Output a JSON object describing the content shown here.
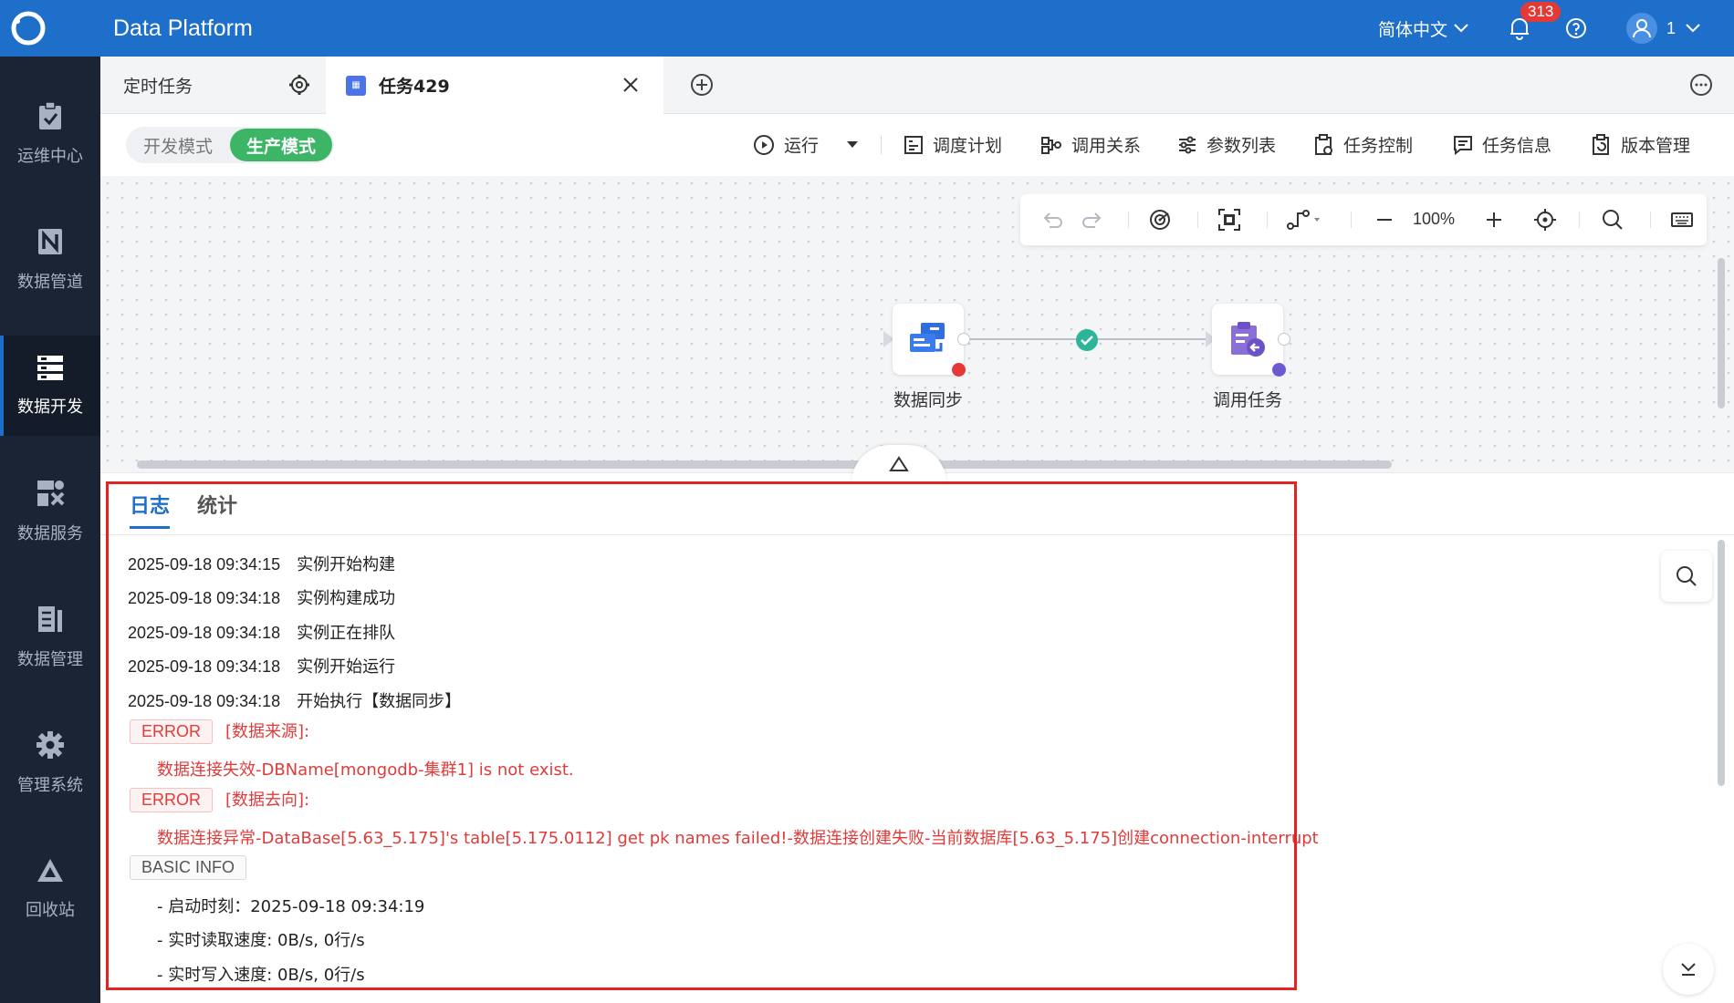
{
  "header": {
    "app_title": "Data Platform",
    "language": "简体中文",
    "notification_count": "313",
    "user_name": "1"
  },
  "sidebar": {
    "items": [
      {
        "label": "运维中心",
        "icon": "clipboard-check-icon"
      },
      {
        "label": "数据管道",
        "icon": "pipeline-icon"
      },
      {
        "label": "数据开发",
        "icon": "server-stack-icon"
      },
      {
        "label": "数据服务",
        "icon": "service-icon"
      },
      {
        "label": "数据管理",
        "icon": "management-icon"
      },
      {
        "label": "管理系统",
        "icon": "gear-icon"
      },
      {
        "label": "回收站",
        "icon": "recycle-icon"
      }
    ],
    "active_index": 2
  },
  "tabs": {
    "items": [
      {
        "label": "定时任务"
      },
      {
        "label": "任务429"
      }
    ]
  },
  "toolbar": {
    "mode_dev": "开发模式",
    "mode_prod": "生产模式",
    "run": "运行",
    "schedule_plan": "调度计划",
    "call_relation": "调用关系",
    "param_list": "参数列表",
    "task_control": "任务控制",
    "task_info": "任务信息",
    "version_mgmt": "版本管理"
  },
  "canvas": {
    "zoom": "100%",
    "nodes": [
      {
        "label": "数据同步",
        "status_color": "#e53935"
      },
      {
        "label": "调用任务",
        "status_color": "#6b5bd2"
      }
    ]
  },
  "log_panel": {
    "tabs": [
      "日志",
      "统计"
    ],
    "lines": [
      {
        "ts": "2025-09-18 09:34:15",
        "msg": "实例开始构建"
      },
      {
        "ts": "2025-09-18 09:34:18",
        "msg": "实例构建成功"
      },
      {
        "ts": "2025-09-18 09:34:18",
        "msg": "实例正在排队"
      },
      {
        "ts": "2025-09-18 09:34:18",
        "msg": "实例开始运行"
      },
      {
        "ts": "2025-09-18 09:34:18",
        "msg": "开始执行【数据同步】"
      }
    ],
    "error1_tag": "ERROR",
    "error1_title": "[数据来源]:",
    "error1_detail": "数据连接失效-DBName[mongodb-集群1] is not exist.",
    "error2_tag": "ERROR",
    "error2_title": "[数据去向]:",
    "error2_detail": "数据连接异常-DataBase[5.63_5.175]'s table[5.175.0112] get pk names failed!-数据连接创建失败-当前数据库[5.63_5.175]创建connection-interrupt",
    "info_tag": "BASIC INFO",
    "info_lines": [
      "- 启动时刻：2025-09-18 09:34:19",
      "- 实时读取速度: 0B/s, 0行/s",
      "- 实时写入速度: 0B/s, 0行/s"
    ]
  },
  "colors": {
    "header_bg": "#1e6fc9",
    "sidebar_bg": "#1b2435",
    "prod_green": "#3cb567",
    "error_red": "#e03b3b",
    "highlight_red": "#e02424"
  }
}
